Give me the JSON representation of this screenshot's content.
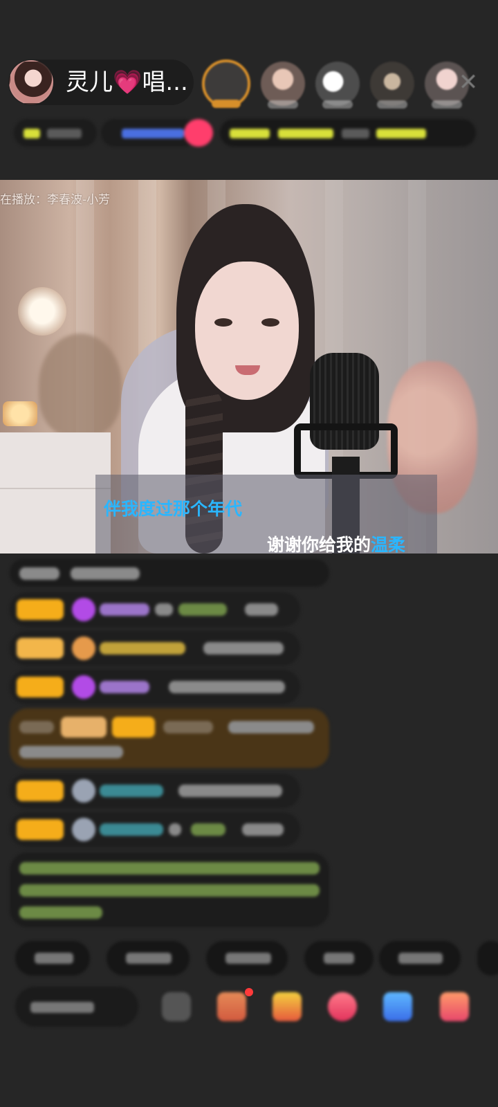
{
  "header": {
    "host_name": "灵儿",
    "host_name_suffix": "唱...",
    "heart_icon": "💗",
    "close_label": "✕",
    "viewers": [
      {
        "name": "viewer-1"
      },
      {
        "name": "viewer-2"
      },
      {
        "name": "viewer-3"
      },
      {
        "name": "viewer-4"
      },
      {
        "name": "viewer-5"
      }
    ],
    "icons": {
      "close": "close-icon",
      "heart": "heart-icon"
    }
  },
  "video": {
    "now_playing": "在播放：李春波-小芳",
    "lyric_line_1": "伴我度过那个年代",
    "lyric_line_2_prefix": "谢谢你给我的",
    "lyric_line_2_highlight": "温柔",
    "highlight_color": "#2ab6ff"
  },
  "colors": {
    "background": "#262626",
    "badge_orange": "#f5ad1a",
    "accent_pink": "#ff3e6c",
    "accent_purple": "#b566e8"
  }
}
